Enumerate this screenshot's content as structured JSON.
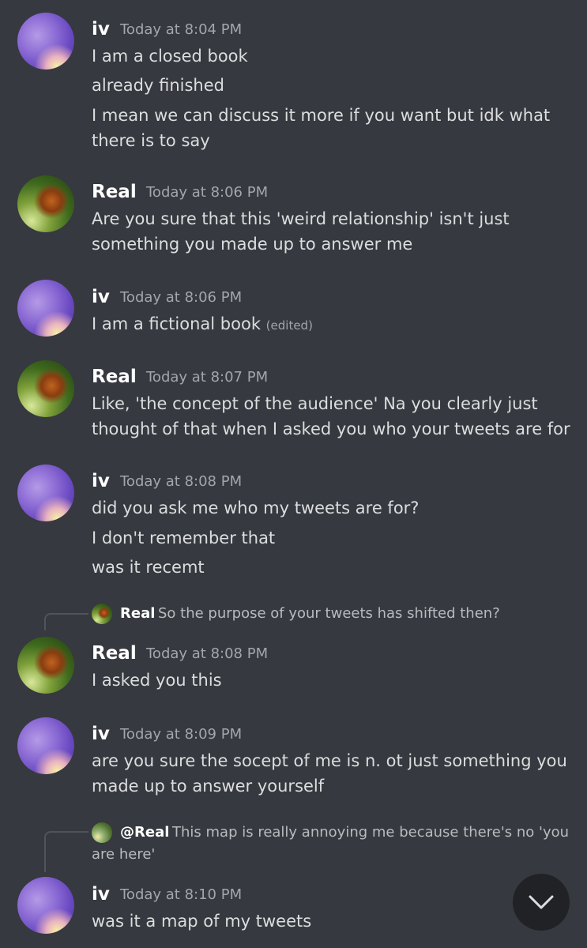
{
  "messages": [
    {
      "author": "iv",
      "time": "Today at 8:04 PM",
      "lines": [
        "I am a closed book",
        "already finished",
        "I mean we can discuss it more if you want but idk what",
        "there is to say"
      ]
    },
    {
      "author": "Real",
      "time": "Today at 8:06 PM",
      "lines": [
        "Are you sure that this 'weird relationship' isn't just",
        "something you made up to answer me"
      ]
    },
    {
      "author": "iv",
      "time": "Today at 8:06 PM",
      "lines": [
        "I am a fictional book"
      ],
      "edited": "(edited)"
    },
    {
      "author": "Real",
      "time": "Today at 8:07 PM",
      "lines": [
        "Like, 'the concept of the audience' Na you clearly just",
        "thought of that when I asked you who your tweets are for"
      ]
    },
    {
      "author": "iv",
      "time": "Today at 8:08 PM",
      "lines": [
        "did you ask me who my tweets are for?",
        "I don't remember that",
        "was it recemt"
      ]
    },
    {
      "author": "Real",
      "time": "Today at 8:08 PM",
      "reply": {
        "name": "Real",
        "text": "So the purpose of your tweets has shifted then?"
      },
      "lines": [
        "I asked you this"
      ]
    },
    {
      "author": "iv",
      "time": "Today at 8:09 PM",
      "lines": [
        "are you sure the socept of me is n. ot just something you",
        "made up to answer yourself"
      ]
    },
    {
      "author": "iv",
      "time": "Today at 8:10 PM",
      "reply": {
        "name": "@Real",
        "text": "This map is really annoying me because there's no 'you",
        "text2": "are here'"
      },
      "lines": [
        "was it a map of my tweets"
      ]
    }
  ],
  "scroll_button": {
    "icon": "chevron-down-icon"
  }
}
